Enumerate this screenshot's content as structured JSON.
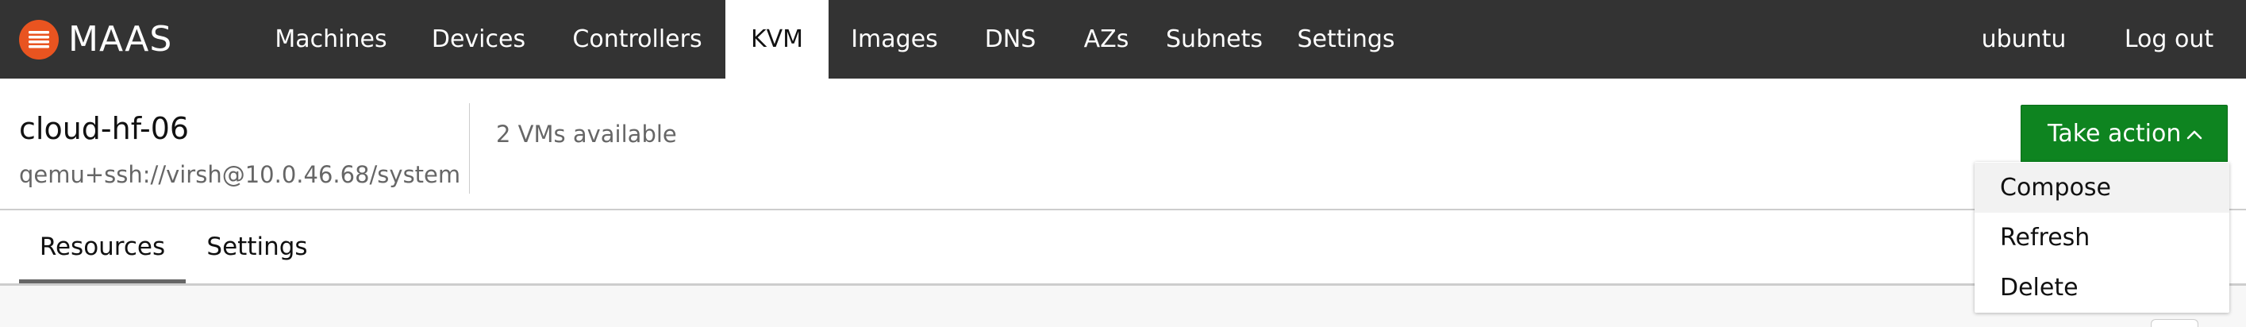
{
  "app": {
    "brand": "MAAS",
    "brand_icon": "maas-logo-icon",
    "brand_color": "#e95420"
  },
  "nav": {
    "items": [
      {
        "label": "Machines"
      },
      {
        "label": "Devices"
      },
      {
        "label": "Controllers"
      },
      {
        "label": "KVM",
        "active": true
      },
      {
        "label": "Images"
      },
      {
        "label": "DNS"
      },
      {
        "label": "AZs"
      },
      {
        "label": "Subnets"
      },
      {
        "label": "Settings"
      }
    ],
    "user": "ubuntu",
    "logout": "Log out"
  },
  "header": {
    "title": "cloud-hf-06",
    "address": "qemu+ssh://virsh@10.0.46.68/system",
    "available": "2 VMs available"
  },
  "action": {
    "label": "Take action",
    "icon": "chevron-up-icon",
    "color": "#0e8420",
    "menu": [
      {
        "label": "Compose",
        "highlighted": true
      },
      {
        "label": "Refresh"
      },
      {
        "label": "Delete"
      }
    ]
  },
  "tabs": [
    {
      "label": "Resources",
      "active": true
    },
    {
      "label": "Settings"
    }
  ]
}
